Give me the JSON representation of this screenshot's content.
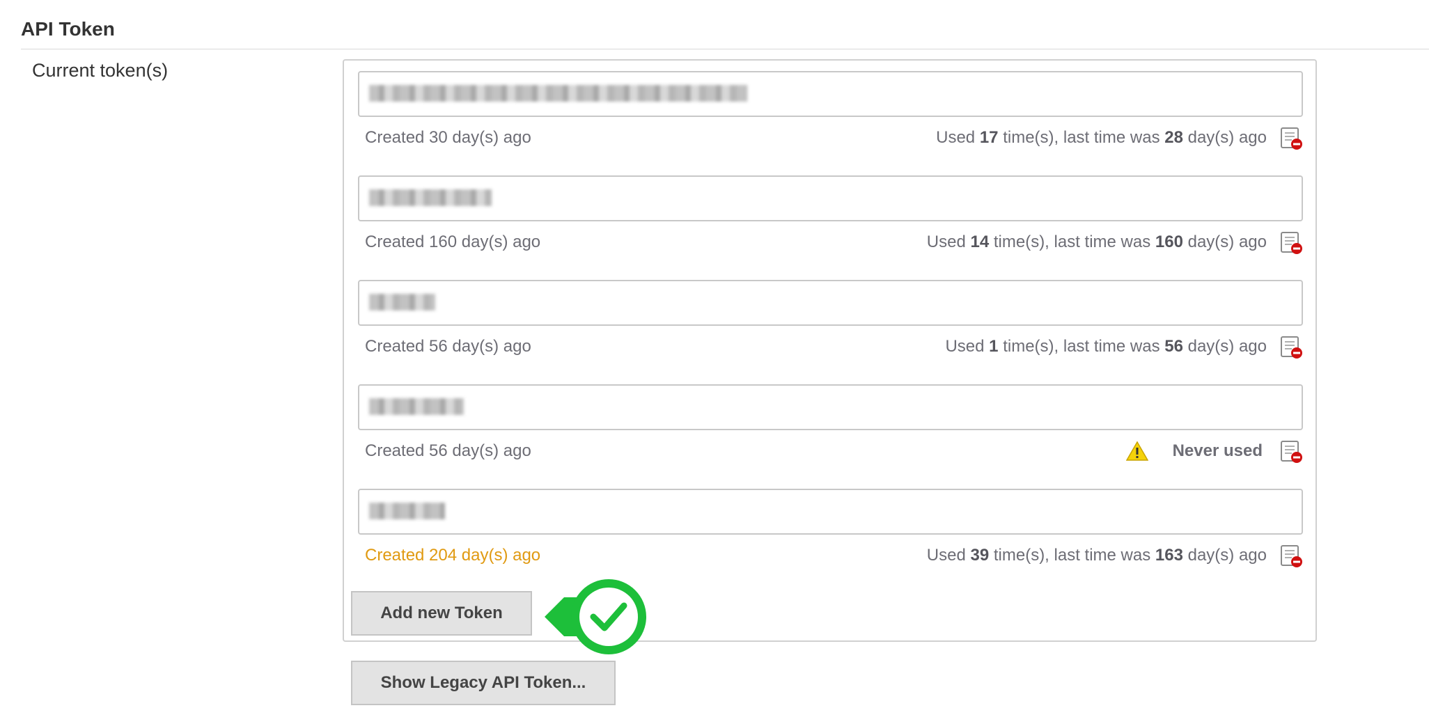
{
  "section": {
    "title": "API Token"
  },
  "field": {
    "label": "Current token(s)"
  },
  "tokens": [
    {
      "created": "Created 30 day(s) ago",
      "old": false,
      "used_prefix": "Used ",
      "used_count": "17",
      "used_mid": " time(s), last time was ",
      "last_days": "28",
      "used_suffix": " day(s) ago",
      "never_used": false,
      "blurred_name_width": 0.4
    },
    {
      "created": "Created 160 day(s) ago",
      "old": false,
      "used_prefix": "Used ",
      "used_count": "14",
      "used_mid": " time(s), last time was ",
      "last_days": "160",
      "used_suffix": " day(s) ago",
      "never_used": false,
      "blurred_name_width": 0.13
    },
    {
      "created": "Created 56 day(s) ago",
      "old": false,
      "used_prefix": "Used ",
      "used_count": "1",
      "used_mid": " time(s), last time was ",
      "last_days": "56",
      "used_suffix": " day(s) ago",
      "never_used": false,
      "blurred_name_width": 0.07
    },
    {
      "created": "Created 56 day(s) ago",
      "old": false,
      "never_used": true,
      "never_label": "Never used",
      "blurred_name_width": 0.1
    },
    {
      "created": "Created 204 day(s) ago",
      "old": true,
      "used_prefix": "Used ",
      "used_count": "39",
      "used_mid": " time(s), last time was ",
      "last_days": "163",
      "used_suffix": " day(s) ago",
      "never_used": false,
      "blurred_name_width": 0.08
    }
  ],
  "buttons": {
    "add_token": "Add new Token",
    "show_legacy": "Show Legacy API Token..."
  },
  "icons": {
    "revoke": "revoke-token-icon",
    "warning": "warning-icon",
    "success_badge": "success-check-icon"
  },
  "colors": {
    "old_token": "#e09a12",
    "badge_green": "#1dbf3a",
    "revoke_red": "#d01010",
    "warning_yellow": "#f5d20a"
  }
}
